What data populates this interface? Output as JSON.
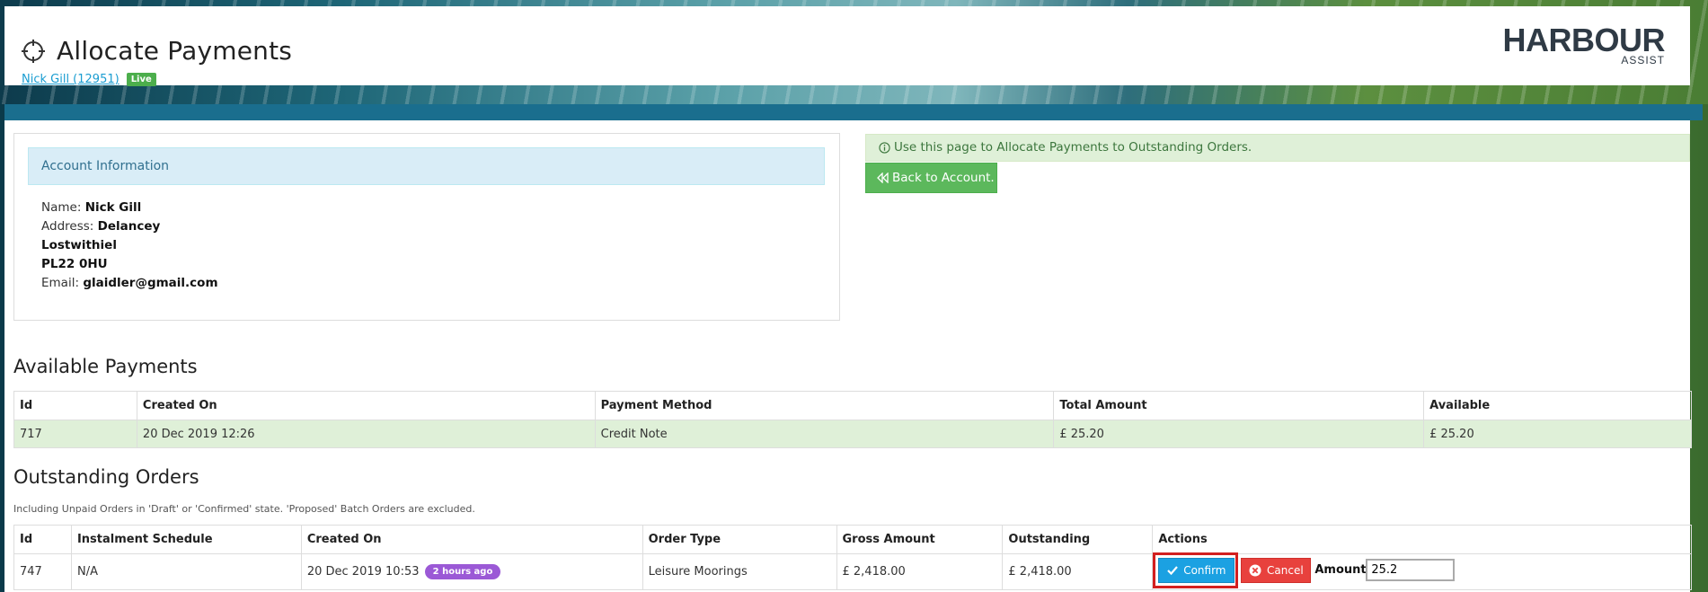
{
  "header": {
    "title": "Allocate Payments",
    "user_link": "Nick Gill (12951)",
    "live_badge": "Live",
    "logo_main": "HARBOUR",
    "logo_sub": "ASSIST"
  },
  "account": {
    "panel_title": "Account Information",
    "name_label": "Name:",
    "name": "Nick Gill",
    "address_label": "Address:",
    "address_line1": "Delancey",
    "address_line2": "Lostwithiel",
    "address_line3": "PL22 0HU",
    "email_label": "Email:",
    "email": "glaidler@gmail.com"
  },
  "info_alert": "Use this page to Allocate Payments to Outstanding Orders.",
  "back_button": "Back to Account.",
  "available_payments": {
    "title": "Available Payments",
    "columns": [
      "Id",
      "Created On",
      "Payment Method",
      "Total Amount",
      "Available"
    ],
    "rows": [
      [
        "717",
        "20 Dec 2019 12:26",
        "Credit Note",
        "£ 25.20",
        "£ 25.20"
      ]
    ]
  },
  "outstanding_orders": {
    "title": "Outstanding Orders",
    "note": "Including Unpaid Orders in 'Draft' or 'Confirmed' state. 'Proposed' Batch Orders are excluded.",
    "columns": [
      "Id",
      "Instalment Schedule",
      "Created On",
      "Order Type",
      "Gross Amount",
      "Outstanding",
      "Actions"
    ],
    "rows": [
      {
        "id": "747",
        "schedule": "N/A",
        "created_on": "20 Dec 2019 10:53",
        "time_badge": "2 hours ago",
        "order_type": "Leisure Moorings",
        "gross": "£ 2,418.00",
        "outstanding": "£ 2,418.00"
      }
    ],
    "confirm_label": "Confirm",
    "cancel_label": "Cancel",
    "amount_label": "Amount:",
    "amount_value": "25.2"
  },
  "colors": {
    "teal_bar": "#1a6e8e",
    "success": "#5cb85c",
    "confirm": "#1ba1e2",
    "cancel": "#e8413d",
    "badge": "#9b59d6"
  }
}
